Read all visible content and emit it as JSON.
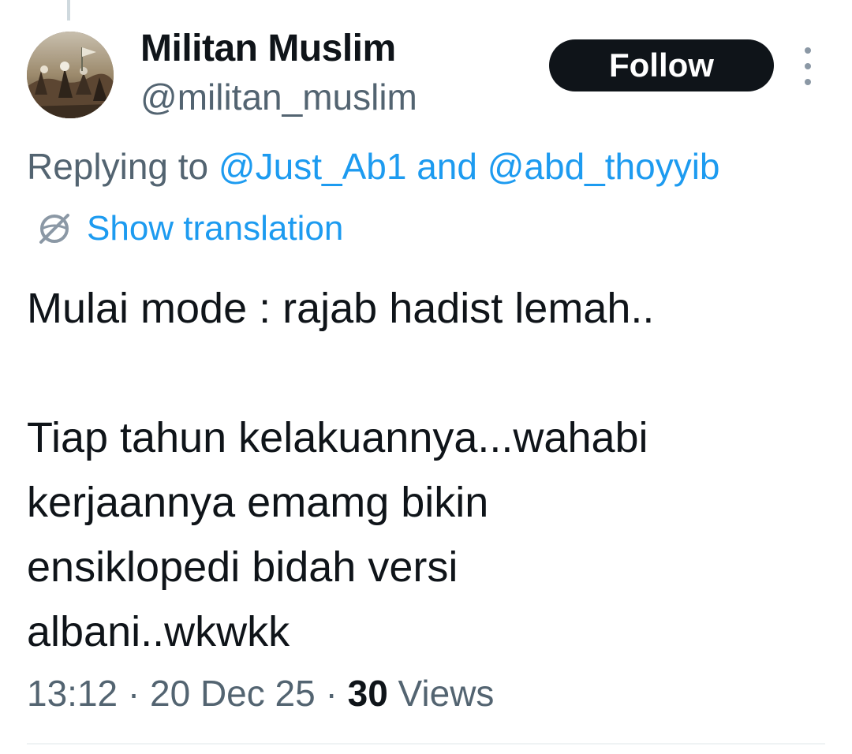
{
  "author": {
    "display_name": "Militan Muslim",
    "handle": "@militan_muslim",
    "avatar": "avatar-image"
  },
  "actions": {
    "follow_label": "Follow",
    "more_icon": "more-vertical-icon"
  },
  "reply": {
    "prefix": "Replying to ",
    "user1": "@Just_Ab1",
    "and": " and ",
    "user2": "@abd_thoyyib"
  },
  "translation": {
    "icon": "globe-icon",
    "label": "Show translation"
  },
  "body": {
    "paragraph1": "Mulai mode : rajab hadist lemah..",
    "paragraph2": "Tiap tahun kelakuannya...wahabi\nkerjaannya emamg bikin\nensiklopedi bidah versi\nalbani..wkwkk"
  },
  "meta": {
    "time": "13:12",
    "separator": " · ",
    "date": "20 Dec 25",
    "views_count": "30",
    "views_label": " Views"
  },
  "colors": {
    "link": "#1d9bf0",
    "secondary_text": "#536471",
    "primary_text": "#0f1419",
    "follow_bg": "#0f1419"
  }
}
